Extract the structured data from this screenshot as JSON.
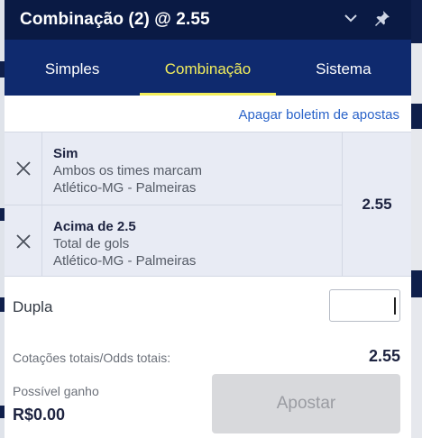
{
  "header": {
    "title": "Combinação (2) @ 2.55",
    "collapse_icon": "chevron-down-icon",
    "pin_icon": "pin-icon"
  },
  "tabs": [
    {
      "label": "Simples",
      "active": false
    },
    {
      "label": "Combinação",
      "active": true
    },
    {
      "label": "Sistema",
      "active": false
    }
  ],
  "clear_link": "Apagar boletim de apostas",
  "selections": [
    {
      "name": "Sim",
      "market": "Ambos os times marcam",
      "event": "Atlético-MG - Palmeiras"
    },
    {
      "name": "Acima de 2.5",
      "market": "Total de gols",
      "event": "Atlético-MG - Palmeiras"
    }
  ],
  "combined_odds": "2.55",
  "stake": {
    "label": "Dupla",
    "value": ""
  },
  "totals": {
    "label": "Cotações totais/Odds totais:",
    "value": "2.55"
  },
  "potential_win": {
    "label": "Possível ganho",
    "value": "R$0.00"
  },
  "place_bet_button": "Apostar",
  "colors": {
    "header_bg": "#0a1a44",
    "tabs_bg": "#0f2a6e",
    "active_tab": "#f3ee5c",
    "link": "#2a63c9"
  }
}
